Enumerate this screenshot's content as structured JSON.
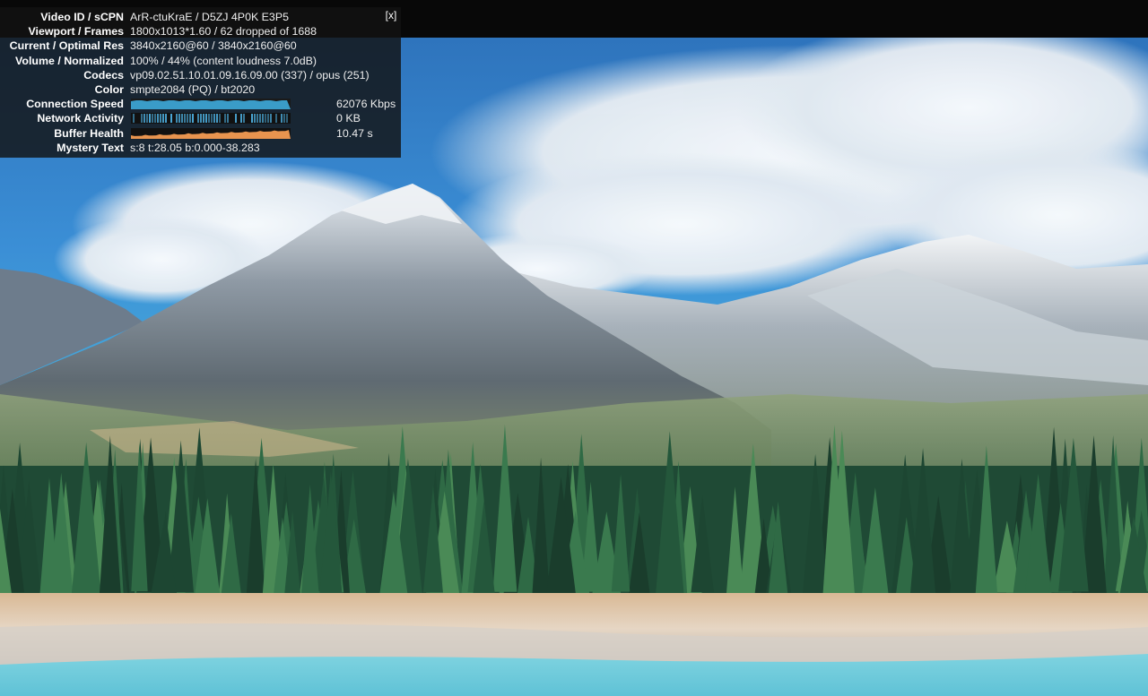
{
  "stats_panel": {
    "close_label": "[x]",
    "rows": [
      {
        "label": "Video ID / sCPN",
        "value": "ArR-ctuKraE / D5ZJ 4P0K E3P5"
      },
      {
        "label": "Viewport / Frames",
        "value": "1800x1013*1.60 / 62 dropped of 1688"
      },
      {
        "label": "Current / Optimal Res",
        "value": "3840x2160@60 / 3840x2160@60"
      },
      {
        "label": "Volume / Normalized",
        "value": "100% / 44% (content loudness 7.0dB)"
      },
      {
        "label": "Codecs",
        "value": "vp09.02.51.10.01.09.16.09.00 (337) / opus (251)"
      },
      {
        "label": "Color",
        "value": "smpte2084 (PQ) / bt2020"
      },
      {
        "label": "Connection Speed",
        "value": "62076 Kbps"
      },
      {
        "label": "Network Activity",
        "value": "0 KB"
      },
      {
        "label": "Buffer Health",
        "value": "10.47 s"
      },
      {
        "label": "Mystery Text",
        "value": "s:8 t:28.05 b:0.000-38.283"
      }
    ],
    "graph_colors": {
      "connection_speed": "#3a9cc8",
      "network_activity": "#4aa7d6",
      "buffer_health": "#e8944f"
    }
  }
}
